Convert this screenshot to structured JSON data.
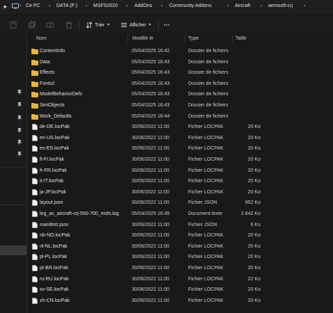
{
  "breadcrumb": [
    "Ce PC",
    "DATA (F:)",
    "MSFS2020",
    "AddOns",
    "Community Addons",
    "Aircraft",
    "aerosoft-crj"
  ],
  "toolbar": {
    "sort_label": "Trier",
    "view_label": "Afficher",
    "more_label": "···"
  },
  "columns": {
    "name": "Nom",
    "modified": "Modifié le",
    "type": "Type",
    "size": "Taille"
  },
  "rows": [
    {
      "name": "ContentInfo",
      "modified": "05/04/2025 16:42",
      "type": "Dossier de fichiers",
      "size": "",
      "icon": "folder-icon"
    },
    {
      "name": "Data",
      "modified": "05/04/2025 16:43",
      "type": "Dossier de fichiers",
      "size": "",
      "icon": "folder-icon"
    },
    {
      "name": "Effects",
      "modified": "05/04/2025 16:43",
      "type": "Dossier de fichiers",
      "size": "",
      "icon": "folder-icon"
    },
    {
      "name": "Fonts2",
      "modified": "05/04/2025 16:43",
      "type": "Dossier de fichiers",
      "size": "",
      "icon": "folder-icon"
    },
    {
      "name": "ModelBehaviorDefs",
      "modified": "05/04/2025 16:43",
      "type": "Dossier de fichiers",
      "size": "",
      "icon": "folder-icon"
    },
    {
      "name": "SimObjects",
      "modified": "05/04/2025 16:43",
      "type": "Dossier de fichiers",
      "size": "",
      "icon": "folder-icon"
    },
    {
      "name": "Work_Defaults",
      "modified": "05/04/2025 16:44",
      "type": "Dossier de fichiers",
      "size": "",
      "icon": "folder-icon"
    },
    {
      "name": "de-DE.locPak",
      "modified": "30/06/2022 11:00",
      "type": "Fichier LOCPAK",
      "size": "20 Ko",
      "icon": "file-icon"
    },
    {
      "name": "en-US.locPak",
      "modified": "30/06/2022 11:00",
      "type": "Fichier LOCPAK",
      "size": "20 Ko",
      "icon": "file-icon"
    },
    {
      "name": "es-ES.locPak",
      "modified": "30/06/2022 11:00",
      "type": "Fichier LOCPAK",
      "size": "20 Ko",
      "icon": "file-icon"
    },
    {
      "name": "fi-FI.locPak",
      "modified": "30/06/2022 11:00",
      "type": "Fichier LOCPAK",
      "size": "20 Ko",
      "icon": "file-icon"
    },
    {
      "name": "fr-FR.locPak",
      "modified": "30/06/2022 11:00",
      "type": "Fichier LOCPAK",
      "size": "20 Ko",
      "icon": "file-icon"
    },
    {
      "name": "it-IT.locPak",
      "modified": "30/06/2022 11:00",
      "type": "Fichier LOCPAK",
      "size": "20 Ko",
      "icon": "file-icon"
    },
    {
      "name": "ja-JP.locPak",
      "modified": "30/06/2022 11:00",
      "type": "Fichier LOCPAK",
      "size": "20 Ko",
      "icon": "file-icon"
    },
    {
      "name": "layout.json",
      "modified": "30/06/2022 11:00",
      "type": "Fichier JSON",
      "size": "952 Ko",
      "icon": "file-icon"
    },
    {
      "name": "log_as_aircraft-crj-550-700_msfs.log",
      "modified": "05/04/2025 16:45",
      "type": "Document texte",
      "size": "2 842 Ko",
      "icon": "file-icon"
    },
    {
      "name": "manifest.json",
      "modified": "30/06/2022 11:00",
      "type": "Fichier JSON",
      "size": "6 Ko",
      "icon": "file-icon"
    },
    {
      "name": "nb-NO.locPak",
      "modified": "30/06/2022 11:00",
      "type": "Fichier LOCPAK",
      "size": "20 Ko",
      "icon": "file-icon"
    },
    {
      "name": "nl-NL.locPak",
      "modified": "30/06/2022 11:00",
      "type": "Fichier LOCPAK",
      "size": "20 Ko",
      "icon": "file-icon"
    },
    {
      "name": "pl-PL.locPak",
      "modified": "30/06/2022 11:00",
      "type": "Fichier LOCPAK",
      "size": "20 Ko",
      "icon": "file-icon"
    },
    {
      "name": "pt-BR.locPak",
      "modified": "30/06/2022 11:00",
      "type": "Fichier LOCPAK",
      "size": "20 Ko",
      "icon": "file-icon"
    },
    {
      "name": "ru-RU.locPak",
      "modified": "30/06/2022 11:00",
      "type": "Fichier LOCPAK",
      "size": "22 Ko",
      "icon": "file-icon"
    },
    {
      "name": "sv-SE.locPak",
      "modified": "30/06/2022 11:00",
      "type": "Fichier LOCPAK",
      "size": "20 Ko",
      "icon": "file-icon"
    },
    {
      "name": "zh-CN.locPak",
      "modified": "30/06/2022 11:00",
      "type": "Fichier LOCPAK",
      "size": "20 Ko",
      "icon": "file-icon"
    }
  ],
  "colors": {
    "folder": "#e8b43a",
    "background": "#191919",
    "text": "#e6e6e6"
  }
}
